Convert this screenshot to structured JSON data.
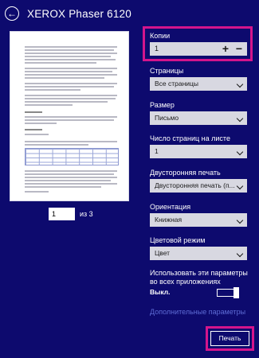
{
  "header": {
    "title": "XEROX Phaser 6120"
  },
  "pager": {
    "current_page": "1",
    "total_label": "из 3"
  },
  "options": {
    "copies": {
      "label": "Копии",
      "value": "1",
      "plus": "+",
      "minus": "−"
    },
    "pages": {
      "label": "Страницы",
      "value": "Все страницы"
    },
    "size": {
      "label": "Размер",
      "value": "Письмо"
    },
    "pages_per_sheet": {
      "label": "Число страниц на листе",
      "value": "1"
    },
    "duplex": {
      "label": "Двусторонняя печать",
      "value": "Двусторонняя печать (п..."
    },
    "orientation": {
      "label": "Ориентация",
      "value": "Книжная"
    },
    "color_mode": {
      "label": "Цветовой режим",
      "value": "Цвет"
    },
    "apply_all": {
      "label": "Использовать эти параметры во всех приложениях",
      "state_label": "Выкл.",
      "on": false
    },
    "more_settings": "Дополнительные параметры"
  },
  "actions": {
    "print": "Печать"
  },
  "colors": {
    "background": "#0d0a6e",
    "highlight": "#d4158c",
    "link": "#5e6cd6",
    "field_bg": "#d8d8e1"
  }
}
